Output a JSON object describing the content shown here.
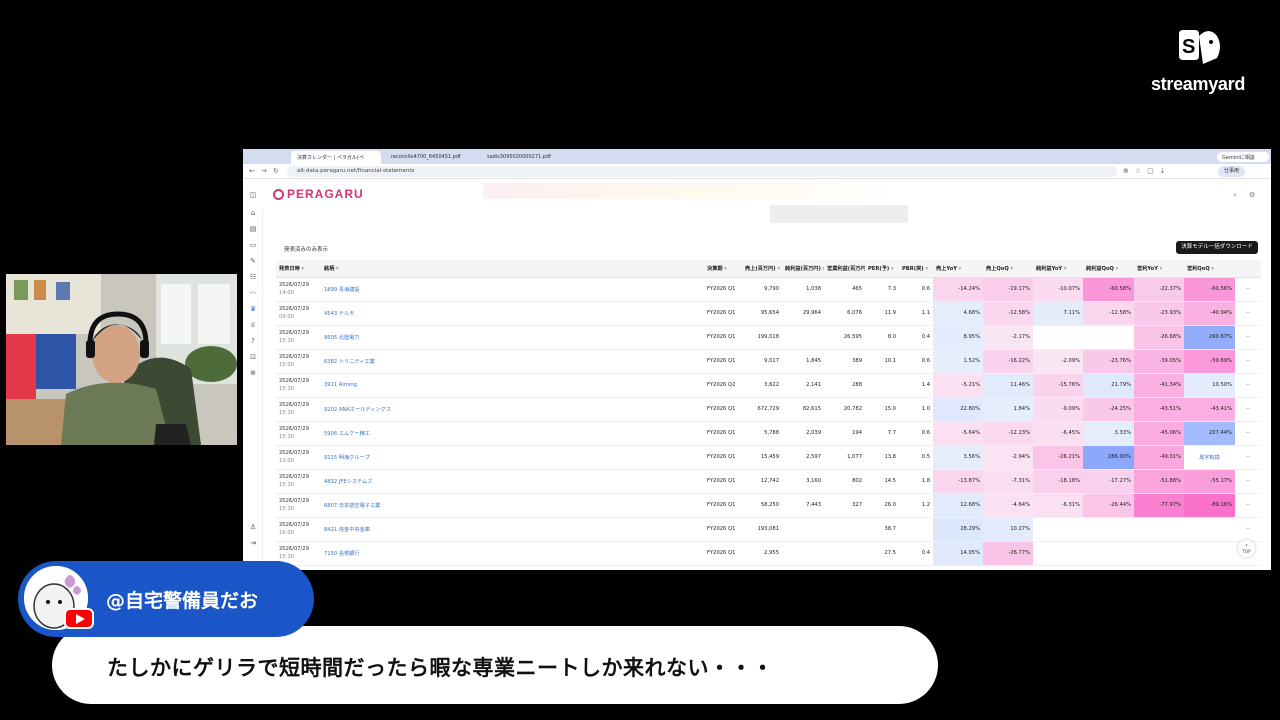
{
  "streamyard": {
    "logo_text": "streamyard"
  },
  "browser": {
    "tabs": [
      {
        "label": "決算カレンダー | ペラガル(ペ"
      },
      {
        "label": "reconcile4700_6450451.pdf"
      },
      {
        "label": "sadis3095020000271.pdf"
      }
    ],
    "sync_chip": "Geminiに相談",
    "url": "alt-data.peragaru.net/financial-statements",
    "profile_label": "仕事用"
  },
  "app": {
    "brand": "PERAGARU",
    "filter_label": "発表済みのみ表示",
    "download_label": "決算モデル一括ダウンロード",
    "top_button": "TOP"
  },
  "table": {
    "headers": [
      "発表日時",
      "銘柄",
      "決算期",
      "売上(百万円)",
      "純利益(百万円)",
      "営業利益(百万円)",
      "PER(予)",
      "PBR(実)",
      "売上YoY",
      "売上QoQ",
      "純利益YoY",
      "純利益QoQ",
      "営利YoY",
      "営利QoQ"
    ],
    "rows": [
      {
        "date": "2026/07/29",
        "time": "14:00",
        "name": "1899 青海建設",
        "period": "FY2026 Q1",
        "sales": "9,790",
        "net": "1,038",
        "op": "465",
        "per": "7.3",
        "pbr": "0.6",
        "s_yoy": "-14.24%",
        "s_qoq": "-19.17%",
        "n_yoy": "-10.07%",
        "n_qoq": "-60.58%",
        "o_yoy": "-22.37%",
        "o_qoq": "-60.56%"
      },
      {
        "date": "2026/07/29",
        "time": "09:00",
        "name": "4543 テルモ",
        "period": "FY2026 Q1",
        "sales": "95,654",
        "net": "29,964",
        "op": "6,076",
        "per": "11.9",
        "pbr": "1.1",
        "s_yoy": "4.68%",
        "s_qoq": "-12.58%",
        "n_yoy": "7.11%",
        "n_qoq": "-12.58%",
        "o_yoy": "-23.93%",
        "o_qoq": "-40.94%"
      },
      {
        "date": "2026/07/29",
        "time": "15:30",
        "name": "9505 北陸電力",
        "period": "FY2026 Q1",
        "sales": "199,018",
        "net": "",
        "op": "26,595",
        "per": "8.0",
        "pbr": "0.4",
        "s_yoy": "8.95%",
        "s_qoq": "-2.17%",
        "n_yoy": "",
        "n_qoq": "",
        "o_yoy": "-26.68%",
        "o_qoq": "260.67%"
      },
      {
        "date": "2026/07/29",
        "time": "15:00",
        "name": "6382 トリニティ工業",
        "period": "FY2026 Q1",
        "sales": "9,017",
        "net": "1,845",
        "op": "389",
        "per": "10.1",
        "pbr": "0.6",
        "s_yoy": "1.52%",
        "s_qoq": "-16.22%",
        "n_yoy": "-2.09%",
        "n_qoq": "-23.76%",
        "o_yoy": "-39.05%",
        "o_qoq": "-59.69%"
      },
      {
        "date": "2026/07/29",
        "time": "15:30",
        "name": "3911 Aiming",
        "period": "FY2026 Q2",
        "sales": "3,622",
        "net": "2,141",
        "op": "288",
        "per": "",
        "pbr": "1.4",
        "s_yoy": "-5.21%",
        "s_qoq": "11.46%",
        "n_yoy": "-15.76%",
        "n_qoq": "21.79%",
        "o_yoy": "-41.34%",
        "o_qoq": "10.50%"
      },
      {
        "date": "2026/07/29",
        "time": "15:30",
        "name": "9202 ANAホールディングス",
        "period": "FY2026 Q1",
        "sales": "672,729",
        "net": "82,615",
        "op": "20,782",
        "per": "15.0",
        "pbr": "1.0",
        "s_yoy": "22.80%",
        "s_qoq": "1.84%",
        "n_yoy": "-9.09%",
        "n_qoq": "-24.25%",
        "o_yoy": "-43.51%",
        "o_qoq": "-43.41%"
      },
      {
        "date": "2026/07/29",
        "time": "15:30",
        "name": "5906 エムケー精工",
        "period": "FY2026 Q1",
        "sales": "5,788",
        "net": "2,039",
        "op": "194",
        "per": "7.7",
        "pbr": "0.6",
        "s_yoy": "-5.64%",
        "s_qoq": "-12.23%",
        "n_yoy": "-6.45%",
        "n_qoq": "3.33%",
        "o_yoy": "-45.06%",
        "o_qoq": "207.44%"
      },
      {
        "date": "2026/07/29",
        "time": "13:00",
        "name": "9115 明海グループ",
        "period": "FY2026 Q1",
        "sales": "15,459",
        "net": "2,597",
        "op": "1,077",
        "per": "13.8",
        "pbr": "0.5",
        "s_yoy": "3.56%",
        "s_qoq": "-2.94%",
        "n_yoy": "-26.21%",
        "n_qoq": "286.00%",
        "o_yoy": "-49.01%",
        "o_qoq": "黒字転換"
      },
      {
        "date": "2026/07/29",
        "time": "15:30",
        "name": "4832 JFEシステムズ",
        "period": "FY2026 Q1",
        "sales": "12,742",
        "net": "3,160",
        "op": "802",
        "per": "14.5",
        "pbr": "1.8",
        "s_yoy": "-13.87%",
        "s_qoq": "-7.31%",
        "n_yoy": "-18.18%",
        "n_qoq": "-17.27%",
        "o_yoy": "-51.88%",
        "o_qoq": "-55.17%"
      },
      {
        "date": "2026/07/29",
        "time": "15:30",
        "name": "6807 日本航空電子工業",
        "period": "FY2026 Q1",
        "sales": "58,250",
        "net": "7,443",
        "op": "327",
        "per": "26.0",
        "pbr": "1.2",
        "s_yoy": "12.68%",
        "s_qoq": "-4.64%",
        "n_yoy": "-6.31%",
        "n_qoq": "-26.44%",
        "o_yoy": "-77.97%",
        "o_qoq": "-89.16%"
      },
      {
        "date": "2026/07/29",
        "time": "16:00",
        "name": "8421 信金中央金庫",
        "period": "FY2026 Q1",
        "sales": "193,081",
        "net": "",
        "op": "",
        "per": "38.7",
        "pbr": "",
        "s_yoy": "28.29%",
        "s_qoq": "10.27%",
        "n_yoy": "",
        "n_qoq": "",
        "o_yoy": "",
        "o_qoq": ""
      },
      {
        "date": "2026/07/29",
        "time": "15:30",
        "name": "7150 島根銀行",
        "period": "FY2026 Q1",
        "sales": "2,955",
        "net": "",
        "op": "",
        "per": "27.5",
        "pbr": "0.4",
        "s_yoy": "14.05%",
        "s_qoq": "-26.77%",
        "n_yoy": "",
        "n_qoq": "",
        "o_yoy": "",
        "o_qoq": ""
      }
    ]
  },
  "comment": {
    "author": "@自宅警備員だお",
    "text": "たしかにゲリラで短時間だったら暇な専業ニートしか来れない・・・"
  },
  "colors": {
    "brand": "#d3356f",
    "comment_pill": "#1a56c8",
    "link": "#3a74c4",
    "youtube": "#ff0000"
  }
}
